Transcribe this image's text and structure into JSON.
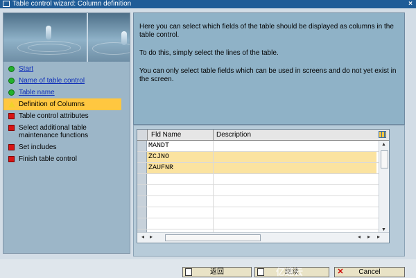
{
  "window": {
    "title": "Table control wizard: Column definition"
  },
  "steps": [
    {
      "label": "Start",
      "status": "done",
      "link": true
    },
    {
      "label": "Name of table control",
      "status": "done",
      "link": true
    },
    {
      "label": "Table name",
      "status": "done",
      "link": true
    },
    {
      "label": "Definition of Columns",
      "status": "current",
      "link": false
    },
    {
      "label": "Table control attributes",
      "status": "pending",
      "link": false
    },
    {
      "label": "Select additional table maintenance functions",
      "status": "pending",
      "link": false
    },
    {
      "label": "Set includes",
      "status": "pending",
      "link": false
    },
    {
      "label": "Finish table control",
      "status": "pending",
      "link": false
    }
  ],
  "info": {
    "line1": "Here you can select which fields of the table should be displayed as columns in the table control.",
    "line2": "To do this, simply select the lines of the table.",
    "line3": "You can only select table fields which can be used in screens and do not yet exist in the screen."
  },
  "grid": {
    "col1": "Fld Name",
    "col2": "Description",
    "rows": [
      {
        "name": "MANDT",
        "desc": "",
        "selected": false
      },
      {
        "name": "ZCJNO",
        "desc": "",
        "selected": true
      },
      {
        "name": "ZAUFNR",
        "desc": "",
        "selected": true
      },
      {
        "name": "",
        "desc": "",
        "selected": false
      },
      {
        "name": "",
        "desc": "",
        "selected": false
      },
      {
        "name": "",
        "desc": "",
        "selected": false
      },
      {
        "name": "",
        "desc": "",
        "selected": false
      },
      {
        "name": "",
        "desc": "",
        "selected": false
      },
      {
        "name": "",
        "desc": "",
        "selected": false
      }
    ]
  },
  "buttons": {
    "back": "返回",
    "continue": "继续",
    "cancel": "Cancel"
  },
  "watermark": "亿速云"
}
